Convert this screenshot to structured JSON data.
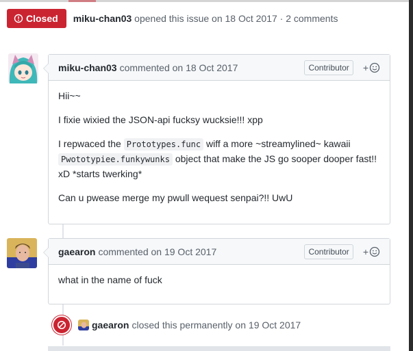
{
  "header": {
    "status_label": "Closed",
    "author": "miku-chan03",
    "opened_text": "opened this issue on 18 Oct 2017 · 2 comments"
  },
  "comments": [
    {
      "author": "miku-chan03",
      "action": "commented on 18 Oct 2017",
      "role": "Contributor",
      "reaction_icon": "smiley-icon",
      "body": {
        "p1": "Hii~~",
        "p2": "I fixie wixied the JSON-api fucksy wucksie!!! xpp",
        "p3_a": "I repwaced the ",
        "p3_code1": "Prototypes.func",
        "p3_b": " wiff a more ~streamylined~ kawaii ",
        "p3_code2": "Pwototypiee.funkywunks",
        "p3_c": " object that make the JS go sooper dooper fast!! xD *starts twerking*",
        "p4": "Can u pwease merge my pwull wequest senpai?!! UwU"
      }
    },
    {
      "author": "gaearon",
      "action": "commented on 19 Oct 2017",
      "role": "Contributor",
      "reaction_icon": "smiley-icon",
      "body": {
        "p1": "what in the name of fuck"
      }
    }
  ],
  "event": {
    "author": "gaearon",
    "action": "closed this permanently on",
    "date": "19 Oct 2017"
  },
  "colors": {
    "closed_red": "#cb2431",
    "header_bg": "#f6f8fa",
    "border": "#d1d5da"
  }
}
